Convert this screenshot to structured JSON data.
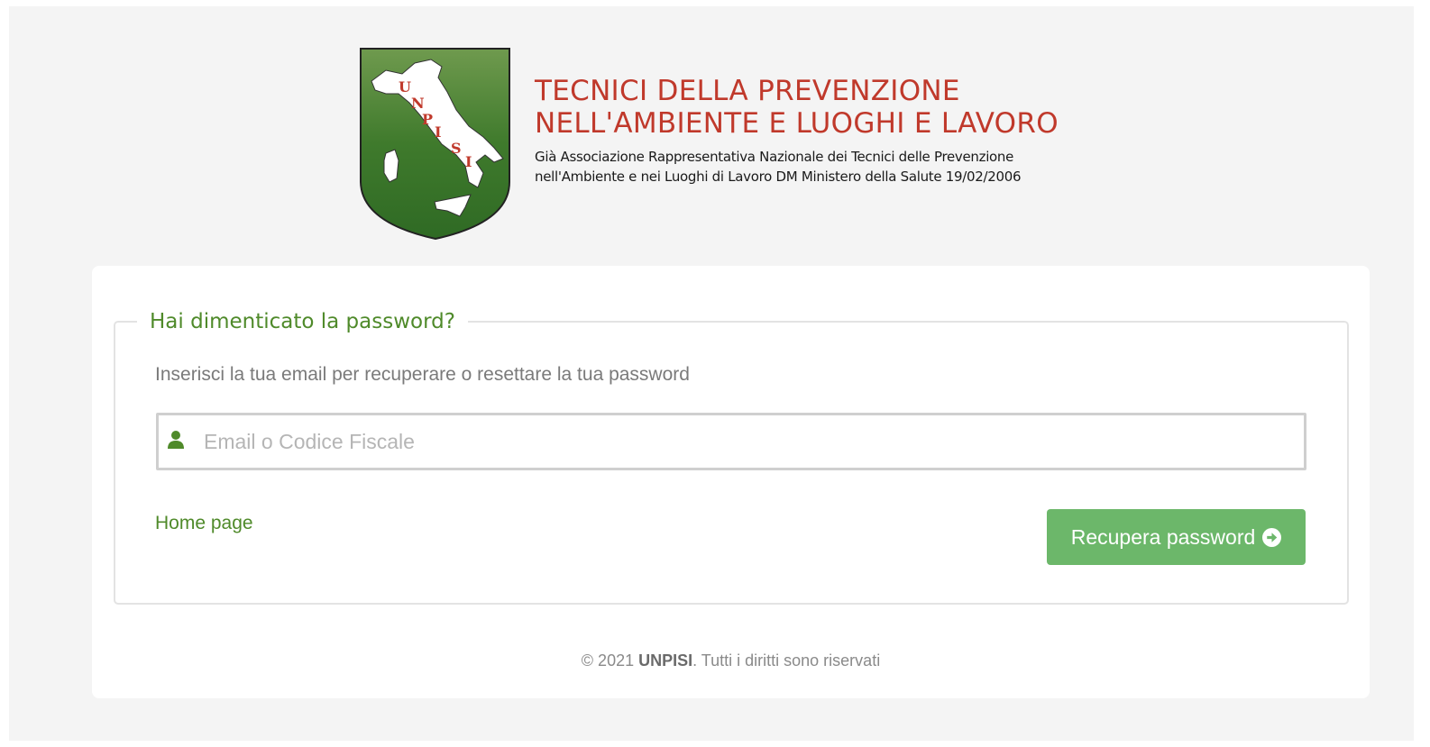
{
  "header": {
    "logo_letters": [
      "U",
      "N",
      "P",
      "I",
      "S",
      "I"
    ],
    "title_line1": "TECNICI DELLA PREVENZIONE",
    "title_line2": "NELL'AMBIENTE E LUOGHI E LAVORO",
    "subtitle_line1": "Già Associazione Rappresentativa Nazionale dei Tecnici delle Prevenzione",
    "subtitle_line2": "nell'Ambiente e nei Luoghi di Lavoro DM Ministero della Salute 19/02/2006",
    "logo_icon": "italy-map-shield-icon"
  },
  "form": {
    "legend": "Hai dimenticato la password?",
    "help_text": "Inserisci la tua email per recuperare o resettare la tua password",
    "email_placeholder": "Email o Codice Fiscale",
    "email_value": "",
    "input_icon": "user-icon",
    "home_link": "Home page",
    "submit_label": "Recupera password",
    "submit_icon": "arrow-circle-right-icon"
  },
  "footer": {
    "prefix": "© 2021 ",
    "brand": "UNPISI",
    "suffix": ". Tutti i diritti sono riservati"
  },
  "colors": {
    "accent_green": "#4f8a2a",
    "button_green": "#6cb76a",
    "title_red": "#c0392b",
    "shield_green": "#4a7d2e"
  }
}
